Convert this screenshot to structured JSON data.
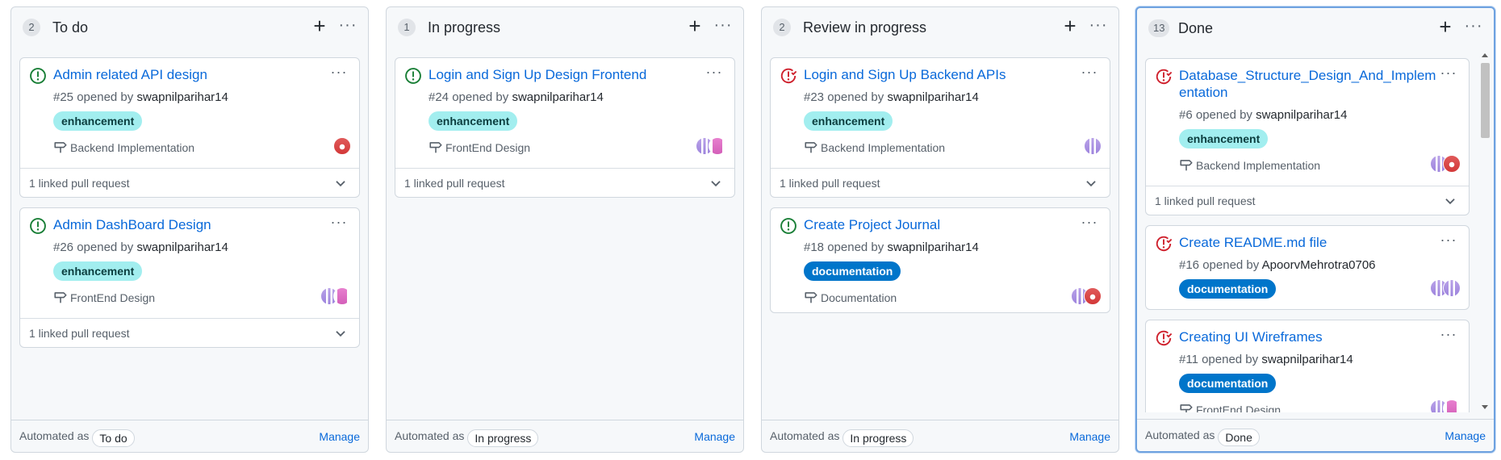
{
  "columns": [
    {
      "count": "2",
      "title": "To do",
      "automated_label": "Automated as",
      "automated_value": "To do",
      "manage": "Manage",
      "cards": [
        {
          "status": "open",
          "title": "Admin related API design",
          "meta_prefix": "#25 opened by",
          "author": "swapnilparihar14",
          "label": "enhancement",
          "milestone": "Backend Implementation",
          "linked": "1 linked pull request",
          "avatars": [
            "red"
          ]
        },
        {
          "status": "open",
          "title": "Admin DashBoard Design",
          "meta_prefix": "#26 opened by",
          "author": "swapnilparihar14",
          "label": "enhancement",
          "milestone": "FrontEnd Design",
          "linked": "1 linked pull request",
          "avatars": [
            "purple",
            "pink"
          ]
        }
      ]
    },
    {
      "count": "1",
      "title": "In progress",
      "automated_label": "Automated as",
      "automated_value": "In progress",
      "manage": "Manage",
      "cards": [
        {
          "status": "open",
          "title": "Login and Sign Up Design Frontend",
          "meta_prefix": "#24 opened by",
          "author": "swapnilparihar14",
          "label": "enhancement",
          "milestone": "FrontEnd Design",
          "linked": "1 linked pull request",
          "avatars": [
            "purple",
            "pink"
          ]
        }
      ]
    },
    {
      "count": "2",
      "title": "Review in progress",
      "automated_label": "Automated as",
      "automated_value": "In progress",
      "manage": "Manage",
      "cards": [
        {
          "status": "closed",
          "title": "Login and Sign Up Backend APIs",
          "meta_prefix": "#23 opened by",
          "author": "swapnilparihar14",
          "label": "enhancement",
          "milestone": "Backend Implementation",
          "linked": "1 linked pull request",
          "avatars": [
            "purple"
          ]
        },
        {
          "status": "open",
          "title": "Create Project Journal",
          "meta_prefix": "#18 opened by",
          "author": "swapnilparihar14",
          "label": "documentation",
          "milestone": "Documentation",
          "linked": "",
          "avatars": [
            "purple",
            "red"
          ]
        }
      ]
    },
    {
      "count": "13",
      "title": "Done",
      "automated_label": "Automated as",
      "automated_value": "Done",
      "manage": "Manage",
      "cards": [
        {
          "status": "closed",
          "title": "Database_Structure_Design_And_Implementation",
          "meta_prefix": "#6 opened by",
          "author": "swapnilparihar14",
          "label": "enhancement",
          "milestone": "Backend Implementation",
          "linked": "1 linked pull request",
          "avatars": [
            "purple",
            "red"
          ]
        },
        {
          "status": "closed",
          "title": "Create README.md file",
          "meta_prefix": "#16 opened by",
          "author": "ApoorvMehrotra0706",
          "label": "documentation",
          "milestone": "",
          "linked": "",
          "avatars": [
            "purple",
            "purple"
          ]
        },
        {
          "status": "closed",
          "title": "Creating UI Wireframes",
          "meta_prefix": "#11 opened by",
          "author": "swapnilparihar14",
          "label": "documentation",
          "milestone": "FrontEnd Design",
          "linked": "",
          "avatars": [
            "purple",
            "pink"
          ]
        }
      ]
    }
  ],
  "icons": {
    "column_add": "plus-icon",
    "column_more": "kebab-horizontal-icon",
    "status_open": "issue-opened-icon",
    "status_closed": "issue-closed-icon",
    "milestone": "milestone-icon",
    "linked_toggle": "chevron-down-icon"
  },
  "colors": {
    "open": "#1a7f37",
    "closed": "#cf222e",
    "link": "#0969da",
    "enhancement_bg": "#a2eeef",
    "documentation_bg": "#0075ca",
    "selected_border": "#6ea2e0"
  }
}
